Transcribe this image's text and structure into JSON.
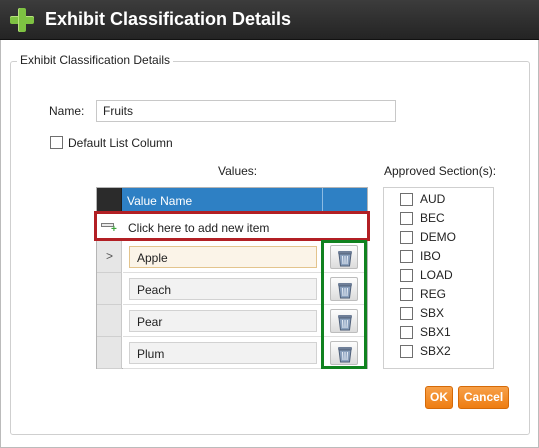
{
  "window": {
    "title": "Exhibit Classification Details",
    "icon": "green-plus-icon"
  },
  "group": {
    "legend": "Exhibit Classification Details"
  },
  "form": {
    "name_label": "Name:",
    "name_value": "Fruits",
    "default_list_column_label": "Default List Column",
    "default_list_column_checked": false
  },
  "values": {
    "label": "Values:",
    "column_header": "Value Name",
    "new_item_text": "Click here to add new item",
    "selected_row_marker": ">",
    "rows": [
      "Apple",
      "Peach",
      "Pear",
      "Plum"
    ],
    "selected_index": 0,
    "delete_icon": "trash-can-icon"
  },
  "approved_sections": {
    "label": "Approved Section(s):",
    "items": [
      {
        "label": "AUD",
        "checked": false
      },
      {
        "label": "BEC",
        "checked": false
      },
      {
        "label": "DEMO",
        "checked": false
      },
      {
        "label": "IBO",
        "checked": false
      },
      {
        "label": "LOAD",
        "checked": false
      },
      {
        "label": "REG",
        "checked": false
      },
      {
        "label": "SBX",
        "checked": false
      },
      {
        "label": "SBX1",
        "checked": false
      },
      {
        "label": "SBX2",
        "checked": false
      }
    ]
  },
  "buttons": {
    "ok": "OK",
    "cancel": "Cancel"
  },
  "colors": {
    "title_bar": "#2d2d2d",
    "grid_header": "#2e80c4",
    "highlight_red": "#b21f24",
    "highlight_green": "#10821f",
    "button_orange": "#ee7d12"
  }
}
